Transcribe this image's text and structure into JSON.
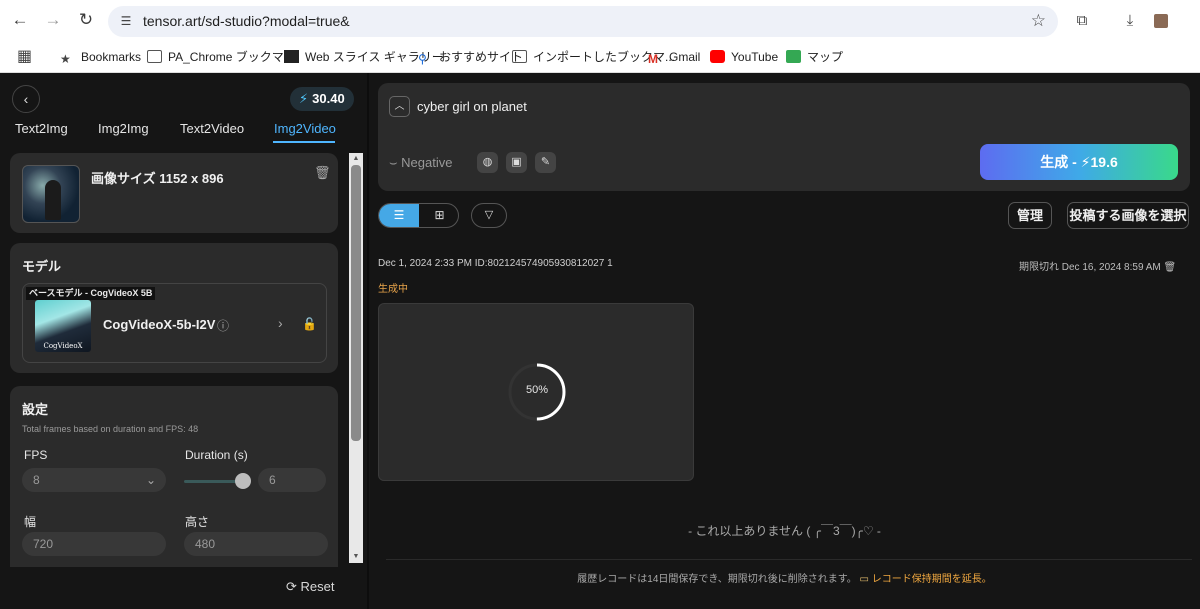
{
  "browser": {
    "url": "tensor.art/sd-studio?modal=true&",
    "bookmarks": [
      {
        "label": "Bookmarks",
        "icon": "star-icon"
      },
      {
        "label": "PA_Chrome ブックマ...",
        "icon": "folder-icon"
      },
      {
        "label": "Web スライス ギャラリー",
        "icon": "web-slice-icon"
      },
      {
        "label": "おすすめサイト",
        "icon": "search-icon"
      },
      {
        "label": "インポートしたブックマ...",
        "icon": "folder-icon"
      },
      {
        "label": "Gmail",
        "icon": "gmail-icon"
      },
      {
        "label": "YouTube",
        "icon": "youtube-icon"
      },
      {
        "label": "マップ",
        "icon": "maps-icon"
      }
    ]
  },
  "sidebar": {
    "credits": "30.40",
    "tabs": [
      {
        "label": "Text2Img",
        "active": false
      },
      {
        "label": "Img2Img",
        "active": false
      },
      {
        "label": "Text2Video",
        "active": false
      },
      {
        "label": "Img2Video",
        "active": true
      }
    ],
    "image_card": {
      "size_label": "画像サイズ 1152 x 896"
    },
    "model": {
      "section_title": "モデル",
      "tag": "ベースモデル - CogVideoX 5B",
      "thumb_text": "CogVideoX",
      "name": "CogVideoX-5b-I2V"
    },
    "settings": {
      "section_title": "設定",
      "description": "Total frames based on duration and FPS: 48",
      "fps_label": "FPS",
      "fps_value": "8",
      "duration_label": "Duration (s)",
      "duration_value": "6",
      "duration_slider_fraction": 0.9,
      "width_label": "幅",
      "width_value": "720",
      "height_label": "高さ",
      "height_value": "480"
    },
    "reset_label": "Reset"
  },
  "main": {
    "prompt": "cyber girl on planet",
    "negative_label": "Negative",
    "generate_label": "生成 -",
    "generate_cost": "19.6",
    "manage_label": "管理",
    "select_label": "投稿する画像を選択",
    "task": {
      "meta": "Dec 1, 2024 2:33 PM ID:802124574905930812027 1",
      "expire": "期限切れ Dec 16, 2024 8:59 AM",
      "status": "生成中",
      "progress_text": "50%",
      "progress": 0.5
    },
    "end_text": "- これ以上ありません ( ╭︎￣3￣)╭︎♡ -",
    "footer_text": "履歴レコードは14日間保存でき、期限切れ後に削除されます。",
    "footer_link": "レコード保持期間を延長。"
  },
  "colors": {
    "accent": "#4fb6ff",
    "status": "#e8a44a",
    "generate_gradient": [
      "#5d6cf0",
      "#3fa9e8",
      "#39d98a"
    ]
  }
}
